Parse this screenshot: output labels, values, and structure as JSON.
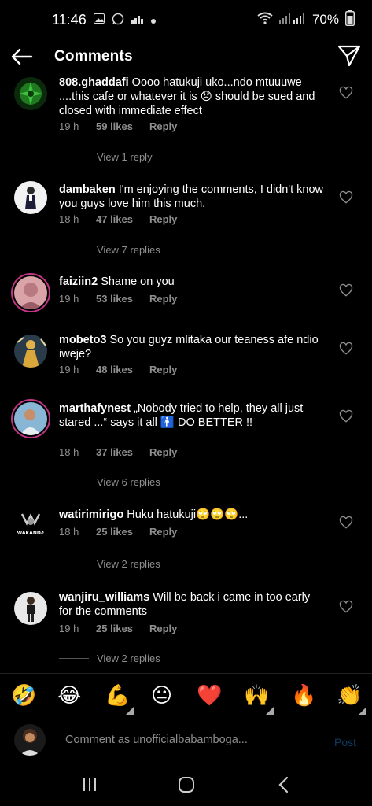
{
  "statusbar": {
    "time": "11:46",
    "battery": "70%"
  },
  "header": {
    "title": "Comments"
  },
  "comments": [
    {
      "username": "808.ghaddafi",
      "text": "Oooo hatukuji uko...ndo mtuuuwe ....this cafe or whatever it is 😞 should be sued and closed with immediate effect",
      "time": "19 h",
      "likes": "59 likes",
      "reply": "Reply",
      "view_replies": "View 1 reply"
    },
    {
      "username": "dambaken",
      "text": "I'm enjoying the comments, I didn't know you guys love him this much.",
      "time": "18 h",
      "likes": "47 likes",
      "reply": "Reply",
      "view_replies": "View 7 replies"
    },
    {
      "username": "faiziin2",
      "text": "Shame on you",
      "time": "19 h",
      "likes": "53 likes",
      "reply": "Reply",
      "view_replies": ""
    },
    {
      "username": "mobeto3",
      "text": "So you guyz mlitaka our teaness afe ndio iweje?",
      "time": "19 h",
      "likes": "48 likes",
      "reply": "Reply",
      "view_replies": ""
    },
    {
      "username": "marthafynest",
      "text": "„Nobody tried to help, they all just stared ...“ says it all 🚹 DO BETTER !!",
      "time": "18 h",
      "likes": "37 likes",
      "reply": "Reply",
      "view_replies": "View 6 replies"
    },
    {
      "username": "watirimirigo",
      "text": "Huku hatukuji🙄🙄🙄...",
      "time": "18 h",
      "likes": "25 likes",
      "reply": "Reply",
      "view_replies": "View 2 replies"
    },
    {
      "username": "wanjiru_williams",
      "text": "Will be back i came in too early for the comments",
      "time": "19 h",
      "likes": "25 likes",
      "reply": "Reply",
      "view_replies": "View 2 replies"
    }
  ],
  "avatar_text": {
    "wakanda": "WAKANDA"
  },
  "reactions": [
    "🤣",
    "😂",
    "💪",
    "😐",
    "❤️",
    "🙌",
    "🔥",
    "👏"
  ],
  "composer": {
    "placeholder": "Comment as unofficialbabamboga...",
    "post": "Post"
  },
  "colors": {
    "accent_post": "#0e3b63",
    "muted": "#8e8e8e",
    "story_ring": "#c13584"
  }
}
